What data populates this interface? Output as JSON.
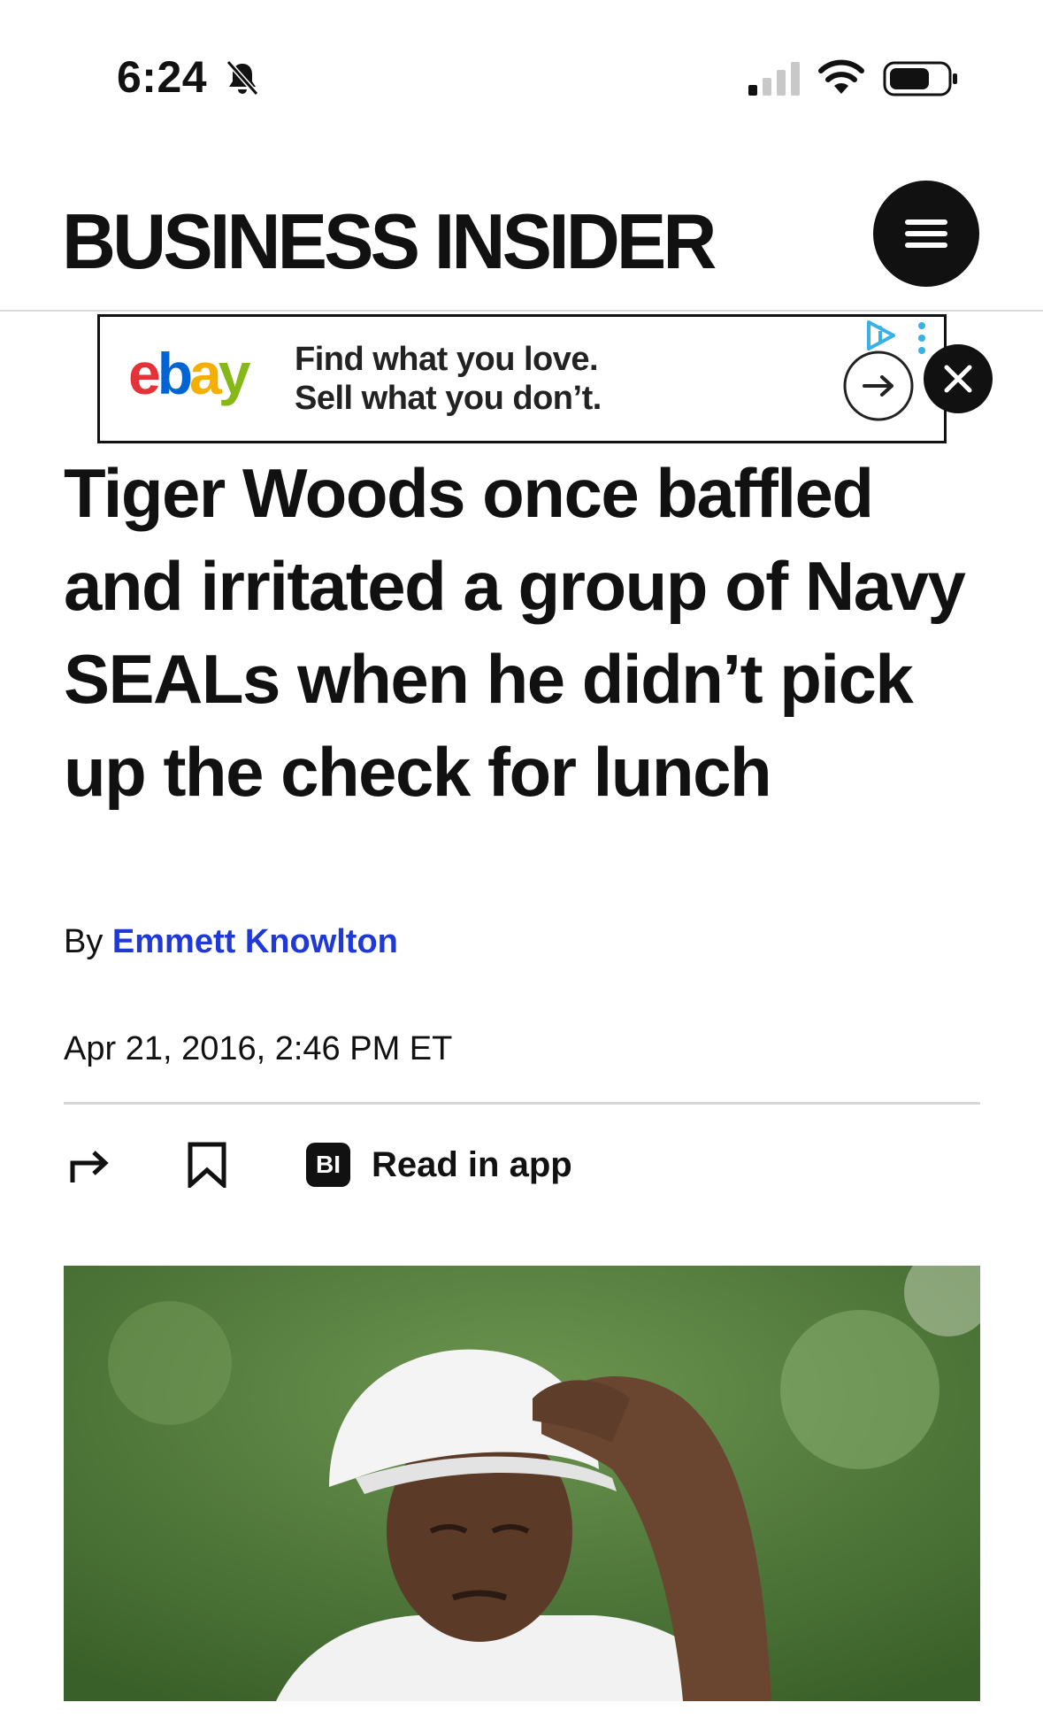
{
  "status_bar": {
    "time": "6:24",
    "icons": [
      "bell-slash-icon",
      "cellular-signal-icon",
      "wifi-icon",
      "battery-icon"
    ]
  },
  "header": {
    "logo": "BUSINESS INSIDER",
    "menu_icon": "hamburger-menu-icon"
  },
  "ad": {
    "brand": {
      "e": "e",
      "b": "b",
      "a": "a",
      "y": "y"
    },
    "line1": "Find what you love.",
    "line2": "Sell what you don’t.",
    "icons": [
      "arrow-right-icon",
      "adchoices-icon",
      "more-vertical-icon",
      "close-icon"
    ],
    "brand_colors": [
      "#e53238",
      "#0064d2",
      "#f5af02",
      "#86b817"
    ]
  },
  "article": {
    "headline": "Tiger Woods once baffled and irritated a group of Navy SEALs when he didn’t pick up the check for lunch",
    "by_prefix": "By ",
    "author": "Emmett Knowlton",
    "date": "Apr 21, 2016, 2:46 PM ET",
    "author_color": "#1f39d6"
  },
  "actions": {
    "share_icon": "share-arrow-icon",
    "bookmark_icon": "bookmark-icon",
    "app_badge": "BI",
    "read_in_app": "Read in app"
  }
}
